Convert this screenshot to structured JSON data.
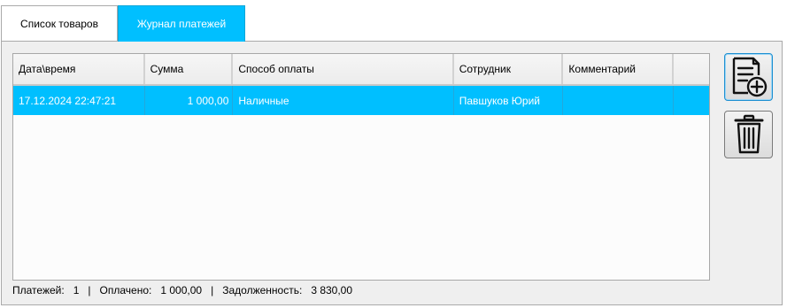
{
  "tabs": [
    {
      "label": "Список товаров",
      "active": false
    },
    {
      "label": "Журнал платежей",
      "active": true
    }
  ],
  "table": {
    "columns": [
      "Дата\\время",
      "Сумма",
      "Способ оплаты",
      "Сотрудник",
      "Комментарий",
      ""
    ],
    "rows": [
      {
        "datetime": "17.12.2024 22:47:21",
        "amount": "1 000,00",
        "method": "Наличные",
        "employee": "Павшуков Юрий",
        "comment": "",
        "selected": true
      }
    ]
  },
  "buttons": {
    "add_icon": "add-document-icon",
    "delete_icon": "trash-icon"
  },
  "status": {
    "payments_label": "Платежей:",
    "payments_value": "1",
    "separator": "|",
    "paid_label": "Оплачено:",
    "paid_value": "1 000,00",
    "debt_label": "Задолженность:",
    "debt_value": "3 830,00"
  },
  "colors": {
    "accent": "#00bfff",
    "panel": "#efefef"
  }
}
